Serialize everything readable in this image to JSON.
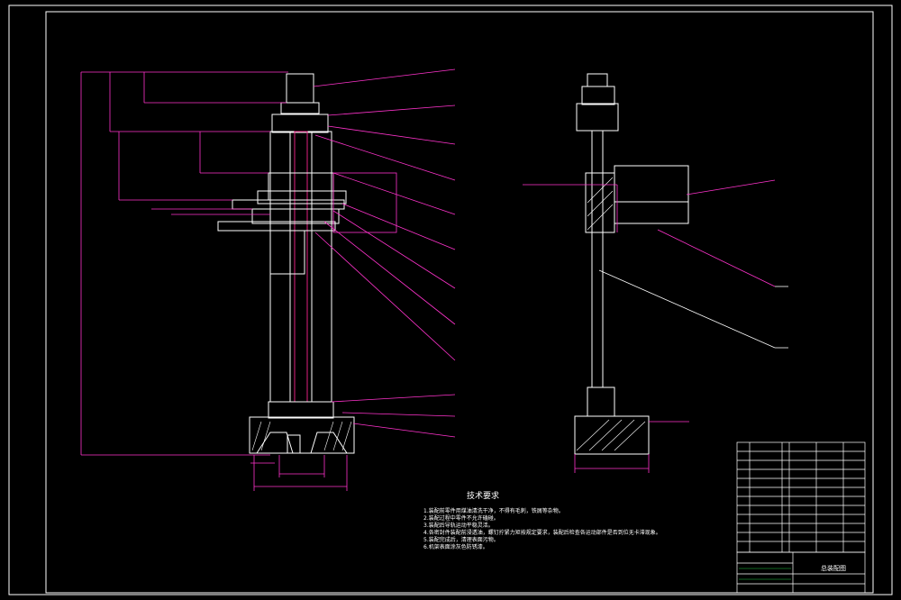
{
  "drawing": {
    "tech_req": {
      "title": "技术要求",
      "items": [
        "1.装配前零件用煤油清洗干净，不得有毛刺，铁屑等杂物。",
        "2.装配过程中零件不允许磕碰。",
        "3.装配后导轨运动平稳灵活。",
        "4.各密封件装配前浸透油，螺钉拧紧力矩按规定要求，装配后检查各运动部件是否到位无卡滞现象。",
        "5.装配完成后，清理表面污物。",
        "6.机架表面涂灰色防锈漆。"
      ]
    },
    "title_block": {
      "drawing_name": "总装配图"
    },
    "colors": {
      "background": "#000000",
      "lines": "#ffffff",
      "dimensions": "#ff33cc",
      "border": "#ffffff"
    }
  }
}
